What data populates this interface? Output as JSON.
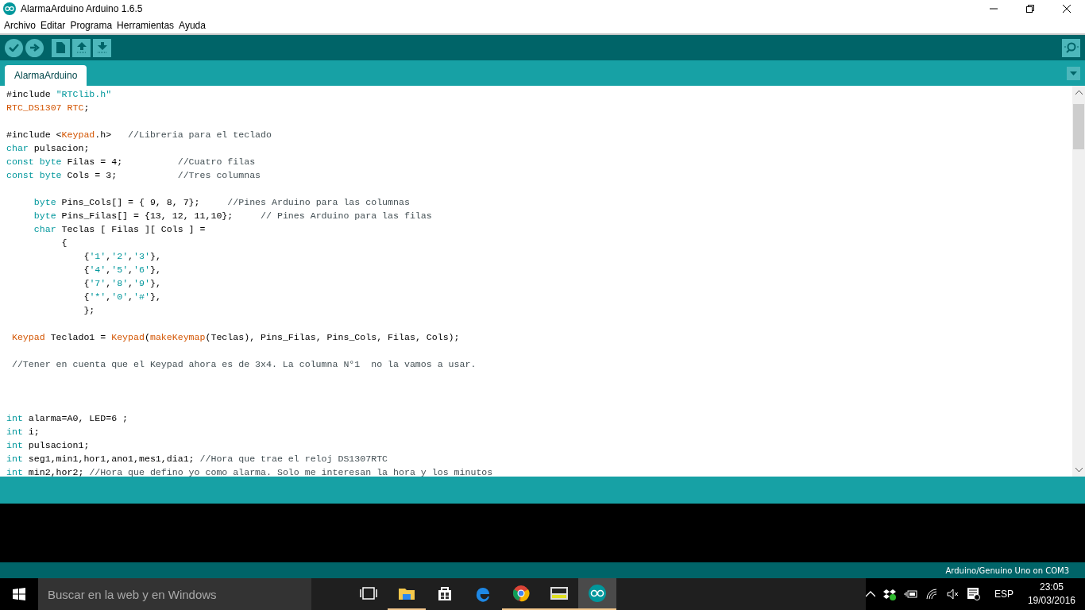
{
  "window": {
    "title": "AlarmaArduino Arduino 1.6.5"
  },
  "menu": [
    "Archivo",
    "Editar",
    "Programa",
    "Herramientas",
    "Ayuda"
  ],
  "tabs": [
    {
      "label": "AlarmaArduino",
      "selected": true
    }
  ],
  "editor": {
    "lines": [
      {
        "kind": "code",
        "tokens": [
          {
            "kind": "plain",
            "text": "#include "
          },
          {
            "kind": "string",
            "text": "\"RTClib.h\""
          }
        ]
      },
      {
        "kind": "code",
        "tokens": [
          {
            "kind": "type",
            "text": "RTC_DS1307 RTC"
          },
          {
            "kind": "plain",
            "text": ";"
          }
        ]
      },
      {
        "kind": "blank"
      },
      {
        "kind": "code",
        "tokens": [
          {
            "kind": "plain",
            "text": "#include <"
          },
          {
            "kind": "type",
            "text": "Keypad"
          },
          {
            "kind": "plain",
            "text": ".h>   "
          },
          {
            "kind": "comment",
            "text": "//Libreria para el teclado"
          }
        ]
      },
      {
        "kind": "code",
        "tokens": [
          {
            "kind": "keyword",
            "text": "char"
          },
          {
            "kind": "plain",
            "text": " pulsacion;"
          }
        ]
      },
      {
        "kind": "code",
        "tokens": [
          {
            "kind": "keyword",
            "text": "const byte"
          },
          {
            "kind": "plain",
            "text": " Filas = 4;          "
          },
          {
            "kind": "comment",
            "text": "//Cuatro filas"
          }
        ]
      },
      {
        "kind": "code",
        "tokens": [
          {
            "kind": "keyword",
            "text": "const byte"
          },
          {
            "kind": "plain",
            "text": " Cols = 3;           "
          },
          {
            "kind": "comment",
            "text": "//Tres columnas"
          }
        ]
      },
      {
        "kind": "blank"
      },
      {
        "kind": "code",
        "tokens": [
          {
            "kind": "keyword",
            "text": "     byte"
          },
          {
            "kind": "plain",
            "text": " Pins_Cols[] = { 9, 8, 7};     "
          },
          {
            "kind": "comment",
            "text": "//Pines Arduino para las columnas"
          }
        ]
      },
      {
        "kind": "code",
        "tokens": [
          {
            "kind": "keyword",
            "text": "     byte"
          },
          {
            "kind": "plain",
            "text": " Pins_Filas[] = {13, 12, 11,10};     "
          },
          {
            "kind": "comment",
            "text": "// Pines Arduino para las filas"
          }
        ]
      },
      {
        "kind": "code",
        "tokens": [
          {
            "kind": "keyword",
            "text": "     char"
          },
          {
            "kind": "plain",
            "text": " Teclas [ Filas ][ Cols ] ="
          }
        ]
      },
      {
        "kind": "code",
        "tokens": [
          {
            "kind": "plain",
            "text": "          {"
          }
        ]
      },
      {
        "kind": "code",
        "tokens": [
          {
            "kind": "plain",
            "text": "              {"
          },
          {
            "kind": "string",
            "text": "'1'"
          },
          {
            "kind": "plain",
            "text": ","
          },
          {
            "kind": "string",
            "text": "'2'"
          },
          {
            "kind": "plain",
            "text": ","
          },
          {
            "kind": "string",
            "text": "'3'"
          },
          {
            "kind": "plain",
            "text": "},"
          }
        ]
      },
      {
        "kind": "code",
        "tokens": [
          {
            "kind": "plain",
            "text": "              {"
          },
          {
            "kind": "string",
            "text": "'4'"
          },
          {
            "kind": "plain",
            "text": ","
          },
          {
            "kind": "string",
            "text": "'5'"
          },
          {
            "kind": "plain",
            "text": ","
          },
          {
            "kind": "string",
            "text": "'6'"
          },
          {
            "kind": "plain",
            "text": "},"
          }
        ]
      },
      {
        "kind": "code",
        "tokens": [
          {
            "kind": "plain",
            "text": "              {"
          },
          {
            "kind": "string",
            "text": "'7'"
          },
          {
            "kind": "plain",
            "text": ","
          },
          {
            "kind": "string",
            "text": "'8'"
          },
          {
            "kind": "plain",
            "text": ","
          },
          {
            "kind": "string",
            "text": "'9'"
          },
          {
            "kind": "plain",
            "text": "},"
          }
        ]
      },
      {
        "kind": "code",
        "tokens": [
          {
            "kind": "plain",
            "text": "              {"
          },
          {
            "kind": "string",
            "text": "'*'"
          },
          {
            "kind": "plain",
            "text": ","
          },
          {
            "kind": "string",
            "text": "'0'"
          },
          {
            "kind": "plain",
            "text": ","
          },
          {
            "kind": "string",
            "text": "'#'"
          },
          {
            "kind": "plain",
            "text": "},"
          }
        ]
      },
      {
        "kind": "code",
        "tokens": [
          {
            "kind": "plain",
            "text": "              };"
          }
        ]
      },
      {
        "kind": "blank"
      },
      {
        "kind": "code",
        "tokens": [
          {
            "kind": "type",
            "text": " Keypad"
          },
          {
            "kind": "plain",
            "text": " Teclado1 = "
          },
          {
            "kind": "type",
            "text": "Keypad"
          },
          {
            "kind": "plain",
            "text": "("
          },
          {
            "kind": "type",
            "text": "makeKeymap"
          },
          {
            "kind": "plain",
            "text": "(Teclas), Pins_Filas, Pins_Cols, Filas, Cols);"
          }
        ]
      },
      {
        "kind": "blank"
      },
      {
        "kind": "code",
        "tokens": [
          {
            "kind": "comment",
            "text": " //Tener en cuenta que el Keypad ahora es de 3x4. La columna N°1  no la vamos a usar."
          }
        ]
      },
      {
        "kind": "blank"
      },
      {
        "kind": "blank"
      },
      {
        "kind": "blank"
      },
      {
        "kind": "code",
        "tokens": [
          {
            "kind": "keyword",
            "text": "int"
          },
          {
            "kind": "plain",
            "text": " alarma=A0, LED=6 ;"
          }
        ]
      },
      {
        "kind": "code",
        "tokens": [
          {
            "kind": "keyword",
            "text": "int"
          },
          {
            "kind": "plain",
            "text": " i;"
          }
        ]
      },
      {
        "kind": "code",
        "tokens": [
          {
            "kind": "keyword",
            "text": "int"
          },
          {
            "kind": "plain",
            "text": " pulsacion1;"
          }
        ]
      },
      {
        "kind": "code",
        "tokens": [
          {
            "kind": "keyword",
            "text": "int"
          },
          {
            "kind": "plain",
            "text": " seg1,min1,hor1,ano1,mes1,dia1; "
          },
          {
            "kind": "comment",
            "text": "//Hora que trae el reloj DS1307RTC"
          }
        ]
      },
      {
        "kind": "code",
        "tokens": [
          {
            "kind": "keyword",
            "text": "int"
          },
          {
            "kind": "plain",
            "text": " min2,hor2; "
          },
          {
            "kind": "comment",
            "text": "//Hora que defino yo como alarma. Solo me interesan la hora y los minutos"
          }
        ]
      }
    ]
  },
  "status_bar": {
    "board": "Arduino/Genuino Uno on COM3"
  },
  "taskbar": {
    "search": {
      "placeholder": "Buscar en la web y en Windows"
    },
    "apps": [
      {
        "kind": "taskview",
        "running": false,
        "active": false
      },
      {
        "kind": "explorer",
        "running": true,
        "active": false
      },
      {
        "kind": "store",
        "running": false,
        "active": false
      },
      {
        "kind": "edge",
        "running": false,
        "active": false
      },
      {
        "kind": "chrome",
        "running": true,
        "active": false
      },
      {
        "kind": "terminal",
        "running": true,
        "active": false
      },
      {
        "kind": "arduino",
        "running": true,
        "active": true
      }
    ],
    "language": "ESP",
    "time": "23:05",
    "date": "19/03/2016"
  }
}
